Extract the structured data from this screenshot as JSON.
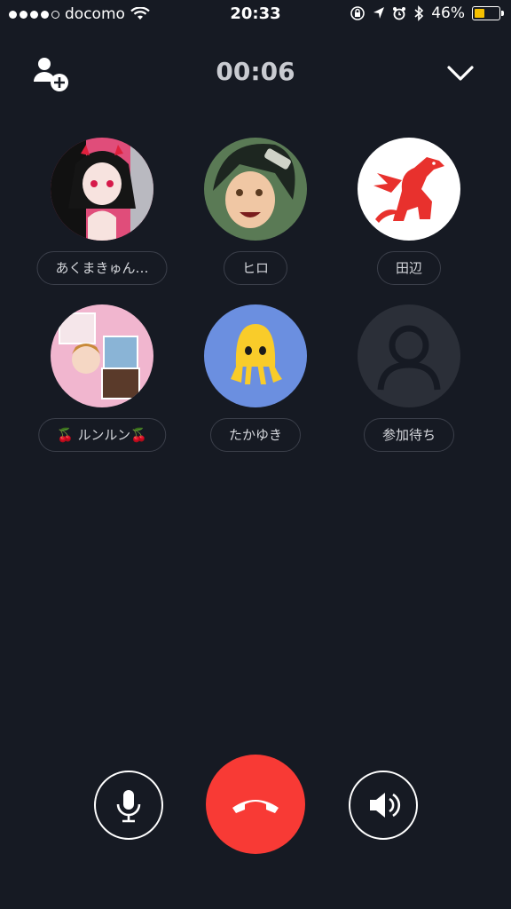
{
  "status_bar": {
    "signal_dots_filled": 4,
    "carrier": "docomo",
    "time": "20:33",
    "battery_percent": "46%",
    "battery_level": 0.46,
    "battery_color": "#f5c000"
  },
  "call": {
    "duration": "00:06"
  },
  "participants": [
    {
      "name": "あくまきゅん…",
      "avatar_bg": "#e04d7a"
    },
    {
      "name": "ヒロ",
      "avatar_bg": "#5a7a55"
    },
    {
      "name": "田辺",
      "avatar_bg": "#ffffff"
    },
    {
      "name": "🍒 ルンルン🍒",
      "avatar_bg": "#f1b6cf"
    },
    {
      "name": "たかゆき",
      "avatar_bg": "#6b8fe0"
    },
    {
      "name": "参加待ち",
      "avatar_bg": "#2b2f38"
    }
  ],
  "controls": {
    "mic_icon": "microphone-icon",
    "hangup_icon": "hangup-icon",
    "speaker_icon": "speaker-icon",
    "hangup_color": "#f83a35"
  }
}
